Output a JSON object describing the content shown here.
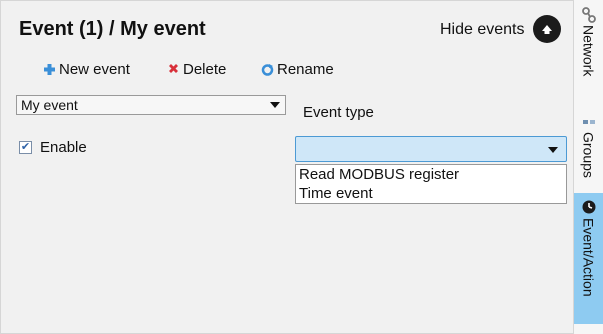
{
  "header": {
    "title": "Event (1) / My event",
    "hide_events_label": "Hide events"
  },
  "toolbar": {
    "new_event": "New event",
    "delete": "Delete",
    "rename": "Rename"
  },
  "event_select": {
    "selected": "My event"
  },
  "event_type": {
    "label": "Event type",
    "selected": ""
  },
  "event_type_options": [
    "Read MODBUS register",
    "Time event"
  ],
  "enable": {
    "label": "Enable",
    "checked": true
  },
  "side_tabs": [
    {
      "label": "Network",
      "icon": "network-icon",
      "active": false
    },
    {
      "label": "Groups",
      "icon": "groups-icon",
      "active": false
    },
    {
      "label": "Event/Action",
      "icon": "clock-icon",
      "active": true
    }
  ],
  "colors": {
    "panel_bg": "#f1f1f1",
    "dropdown_highlight": "#cfe7f8",
    "active_tab": "#8ecbf1"
  }
}
